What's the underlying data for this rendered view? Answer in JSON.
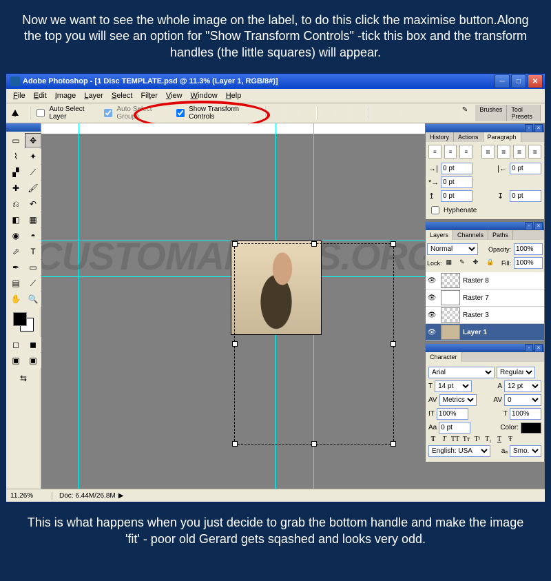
{
  "instruction_top": "Now we want to see the whole image on the label, to do this click the maximise button.Along the top you will see an option for \"Show Transform Controls\" -tick this box and the transform handles (the little squares) will appear.",
  "instruction_bottom": "This is what happens when you just decide to grab the bottom handle and make the image 'fit' - poor old Gerard gets sqashed and looks very odd.",
  "title": "Adobe Photoshop - [1 Disc TEMPLATE.psd @ 11.3% (Layer 1, RGB/8#)]",
  "menu": {
    "file": "File",
    "edit": "Edit",
    "image": "Image",
    "layer": "Layer",
    "select": "Select",
    "filter": "Filter",
    "view": "View",
    "window": "Window",
    "help": "Help"
  },
  "options": {
    "auto_select_layer": "Auto Select Layer",
    "auto_select_groups": "Auto Select Groups",
    "show_transform": "Show Transform Controls"
  },
  "right_tools": {
    "brushes": "Brushes",
    "tool_presets": "Tool Presets"
  },
  "paragraph": {
    "tabs": {
      "history": "History",
      "actions": "Actions",
      "paragraph": "Paragraph"
    },
    "indent_left": "0 pt",
    "indent_right": "0 pt",
    "first_line": "0 pt",
    "space_before": "0 pt",
    "space_after": "0 pt",
    "hyphenate": "Hyphenate"
  },
  "layers": {
    "tabs": {
      "layers": "Layers",
      "channels": "Channels",
      "paths": "Paths"
    },
    "blend": "Normal",
    "opacity_lbl": "Opacity:",
    "opacity": "100%",
    "lock_lbl": "Lock:",
    "fill_lbl": "Fill:",
    "fill": "100%",
    "items": [
      {
        "name": "Raster 8"
      },
      {
        "name": "Raster 7"
      },
      {
        "name": "Raster 3"
      },
      {
        "name": "Layer 1"
      }
    ]
  },
  "character": {
    "tab": "Character",
    "font": "Arial",
    "style": "Regular",
    "size": "14 pt",
    "leading": "12 pt",
    "kerning": "Metrics",
    "tracking": "0",
    "vscale": "100%",
    "hscale": "100%",
    "baseline": "0 pt",
    "color_lbl": "Color:",
    "lang": "English: USA",
    "aa": "Smo..."
  },
  "status": {
    "zoom": "11.26%",
    "doc": "Doc: 6.44M/26.8M"
  },
  "watermark": "CUSTOMANIACS.ORG"
}
